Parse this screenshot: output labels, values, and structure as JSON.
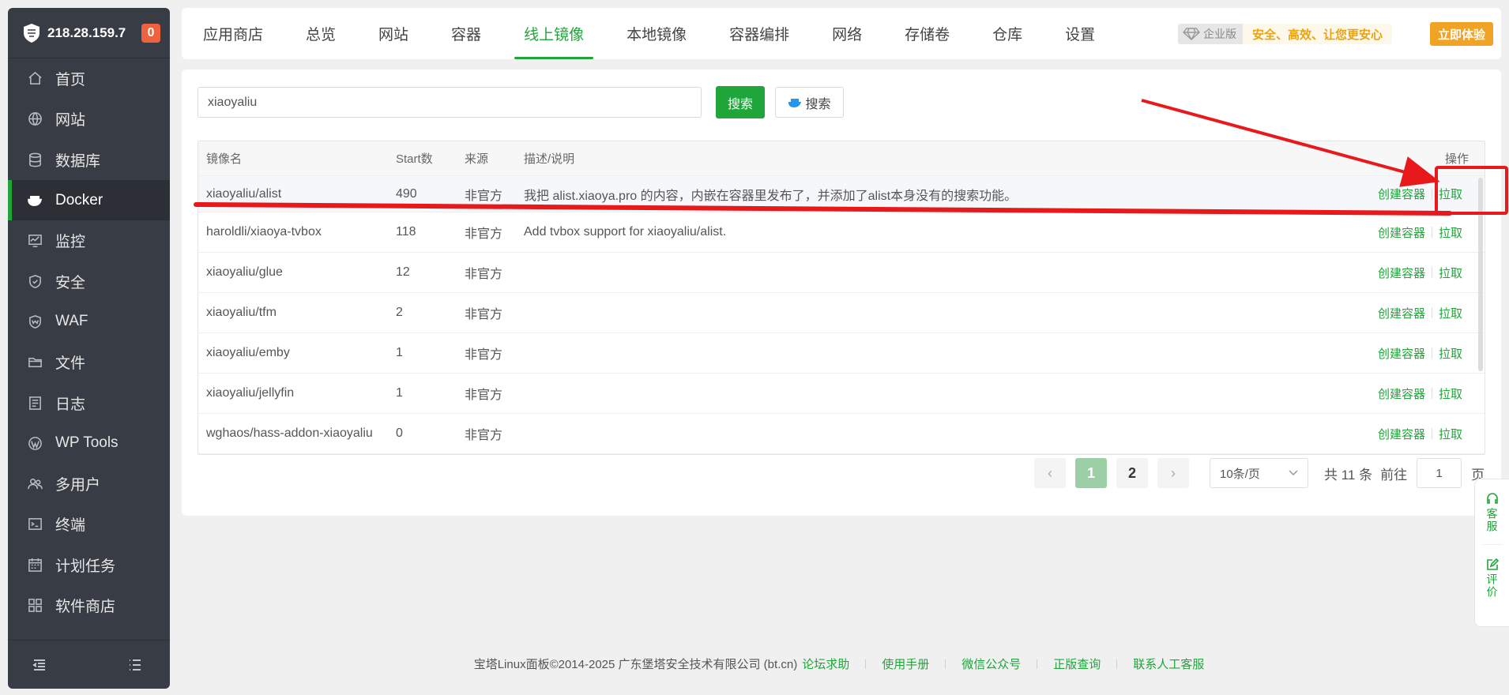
{
  "sidebar": {
    "ip": "218.28.159.7",
    "badge": "0",
    "items": [
      {
        "label": "首页",
        "icon": "home-icon"
      },
      {
        "label": "网站",
        "icon": "globe-icon"
      },
      {
        "label": "数据库",
        "icon": "database-icon"
      },
      {
        "label": "Docker",
        "icon": "docker-icon"
      },
      {
        "label": "监控",
        "icon": "monitor-icon"
      },
      {
        "label": "安全",
        "icon": "shield-icon"
      },
      {
        "label": "WAF",
        "icon": "waf-shield-icon"
      },
      {
        "label": "文件",
        "icon": "folder-icon"
      },
      {
        "label": "日志",
        "icon": "log-icon"
      },
      {
        "label": "WP Tools",
        "icon": "wordpress-icon"
      },
      {
        "label": "多用户",
        "icon": "users-icon"
      },
      {
        "label": "终端",
        "icon": "terminal-icon"
      },
      {
        "label": "计划任务",
        "icon": "calendar-icon"
      },
      {
        "label": "软件商店",
        "icon": "apps-grid-icon"
      }
    ],
    "active_index": 3
  },
  "tabs": [
    {
      "label": "应用商店"
    },
    {
      "label": "总览"
    },
    {
      "label": "网站"
    },
    {
      "label": "容器"
    },
    {
      "label": "线上镜像"
    },
    {
      "label": "本地镜像"
    },
    {
      "label": "容器编排"
    },
    {
      "label": "网络"
    },
    {
      "label": "存储卷"
    },
    {
      "label": "仓库"
    },
    {
      "label": "设置"
    }
  ],
  "active_tab": 4,
  "enterprise": {
    "badge": "企业版",
    "slogan": "安全、高效、让您更安心",
    "try_button": "立即体验"
  },
  "search": {
    "value": "xiaoyaliu",
    "search_button": "搜索",
    "docker_search_button": "搜索"
  },
  "table": {
    "headers": {
      "name": "镜像名",
      "stars": "Start数",
      "source": "来源",
      "desc": "描述/说明",
      "action": "操作"
    },
    "action_create": "创建容器",
    "action_pull": "拉取",
    "rows": [
      {
        "name": "xiaoyaliu/alist",
        "stars": "490",
        "source": "非官方",
        "desc": "我把 alist.xiaoya.pro 的内容，内嵌在容器里发布了，并添加了alist本身没有的搜索功能。"
      },
      {
        "name": "haroldli/xiaoya-tvbox",
        "stars": "118",
        "source": "非官方",
        "desc": "Add tvbox support for xiaoyaliu/alist."
      },
      {
        "name": "xiaoyaliu/glue",
        "stars": "12",
        "source": "非官方",
        "desc": ""
      },
      {
        "name": "xiaoyaliu/tfm",
        "stars": "2",
        "source": "非官方",
        "desc": ""
      },
      {
        "name": "xiaoyaliu/emby",
        "stars": "1",
        "source": "非官方",
        "desc": ""
      },
      {
        "name": "xiaoyaliu/jellyfin",
        "stars": "1",
        "source": "非官方",
        "desc": ""
      },
      {
        "name": "wghaos/hass-addon-xiaoyaliu",
        "stars": "0",
        "source": "非官方",
        "desc": ""
      }
    ]
  },
  "pagination": {
    "prev": "‹",
    "next": "›",
    "pages": [
      "1",
      "2"
    ],
    "current": "1",
    "page_size": "10条/页",
    "total": "共 11 条",
    "goto": "前往",
    "goto_value": "1",
    "page_suffix": "页"
  },
  "float_widget": {
    "service": "客服",
    "review": "评价"
  },
  "footer": {
    "copyright": "宝塔Linux面板©2014-2025 广东堡塔安全技术有限公司 (bt.cn)",
    "links": [
      "论坛求助",
      "使用手册",
      "微信公众号",
      "正版查询",
      "联系人工客服"
    ]
  },
  "colors": {
    "accent": "#20a53a",
    "sidebar_bg": "#383c44",
    "annotation": "#e8191c",
    "enterprise": "#f1a325"
  }
}
